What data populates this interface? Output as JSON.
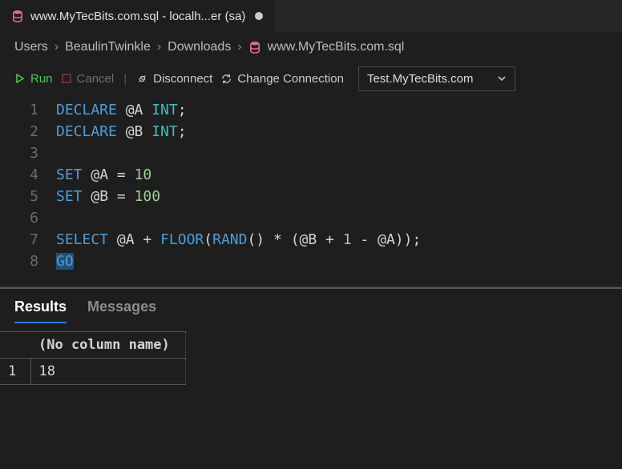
{
  "tab": {
    "title": "www.MyTecBits.com.sql - localh...er (sa)"
  },
  "breadcrumb": {
    "path": [
      "Users",
      "BeaulinTwinkle",
      "Downloads"
    ],
    "file": "www.MyTecBits.com.sql"
  },
  "toolbar": {
    "run": "Run",
    "cancel": "Cancel",
    "disconnect": "Disconnect",
    "change_conn": "Change Connection",
    "connection_selected": "Test.MyTecBits.com"
  },
  "editor": {
    "lines": [
      {
        "n": 1,
        "tokens": [
          [
            "kw-blue",
            "DECLARE"
          ],
          [
            "var",
            " @A "
          ],
          [
            "kw-teal",
            "INT"
          ],
          [
            "punct",
            ";"
          ]
        ]
      },
      {
        "n": 2,
        "tokens": [
          [
            "kw-blue",
            "DECLARE"
          ],
          [
            "var",
            " @B "
          ],
          [
            "kw-teal",
            "INT"
          ],
          [
            "punct",
            ";"
          ]
        ]
      },
      {
        "n": 3,
        "tokens": [
          [
            "var",
            ""
          ]
        ]
      },
      {
        "n": 4,
        "tokens": [
          [
            "kw-blue",
            "SET"
          ],
          [
            "var",
            " @A "
          ],
          [
            "punct",
            "="
          ],
          [
            "var",
            " "
          ],
          [
            "lit-green",
            "10"
          ]
        ]
      },
      {
        "n": 5,
        "tokens": [
          [
            "kw-blue",
            "SET"
          ],
          [
            "var",
            " @B "
          ],
          [
            "punct",
            "="
          ],
          [
            "var",
            " "
          ],
          [
            "lit-green",
            "100"
          ]
        ]
      },
      {
        "n": 6,
        "tokens": [
          [
            "var",
            ""
          ]
        ]
      },
      {
        "n": 7,
        "tokens": [
          [
            "kw-blue",
            "SELECT"
          ],
          [
            "var",
            " @A "
          ],
          [
            "punct",
            "+"
          ],
          [
            "var",
            " "
          ],
          [
            "fn-blue",
            "FLOOR"
          ],
          [
            "punct",
            "("
          ],
          [
            "fn-blue",
            "RAND"
          ],
          [
            "punct",
            "()"
          ],
          [
            "var",
            " "
          ],
          [
            "punct",
            "*"
          ],
          [
            "var",
            " "
          ],
          [
            "punct",
            "("
          ],
          [
            "var",
            "@B "
          ],
          [
            "punct",
            "+"
          ],
          [
            "var",
            " "
          ],
          [
            "lit-green",
            "1"
          ],
          [
            "var",
            " "
          ],
          [
            "punct",
            "-"
          ],
          [
            "var",
            " @A"
          ],
          [
            "punct",
            "));"
          ]
        ]
      },
      {
        "n": 8,
        "tokens": [
          [
            "kw-blue sel-bg",
            "GO"
          ]
        ]
      }
    ]
  },
  "panel": {
    "tabs": {
      "results": "Results",
      "messages": "Messages",
      "active": "results"
    },
    "header": "(No column name)",
    "rows": [
      {
        "n": "1",
        "value": "18"
      }
    ]
  }
}
